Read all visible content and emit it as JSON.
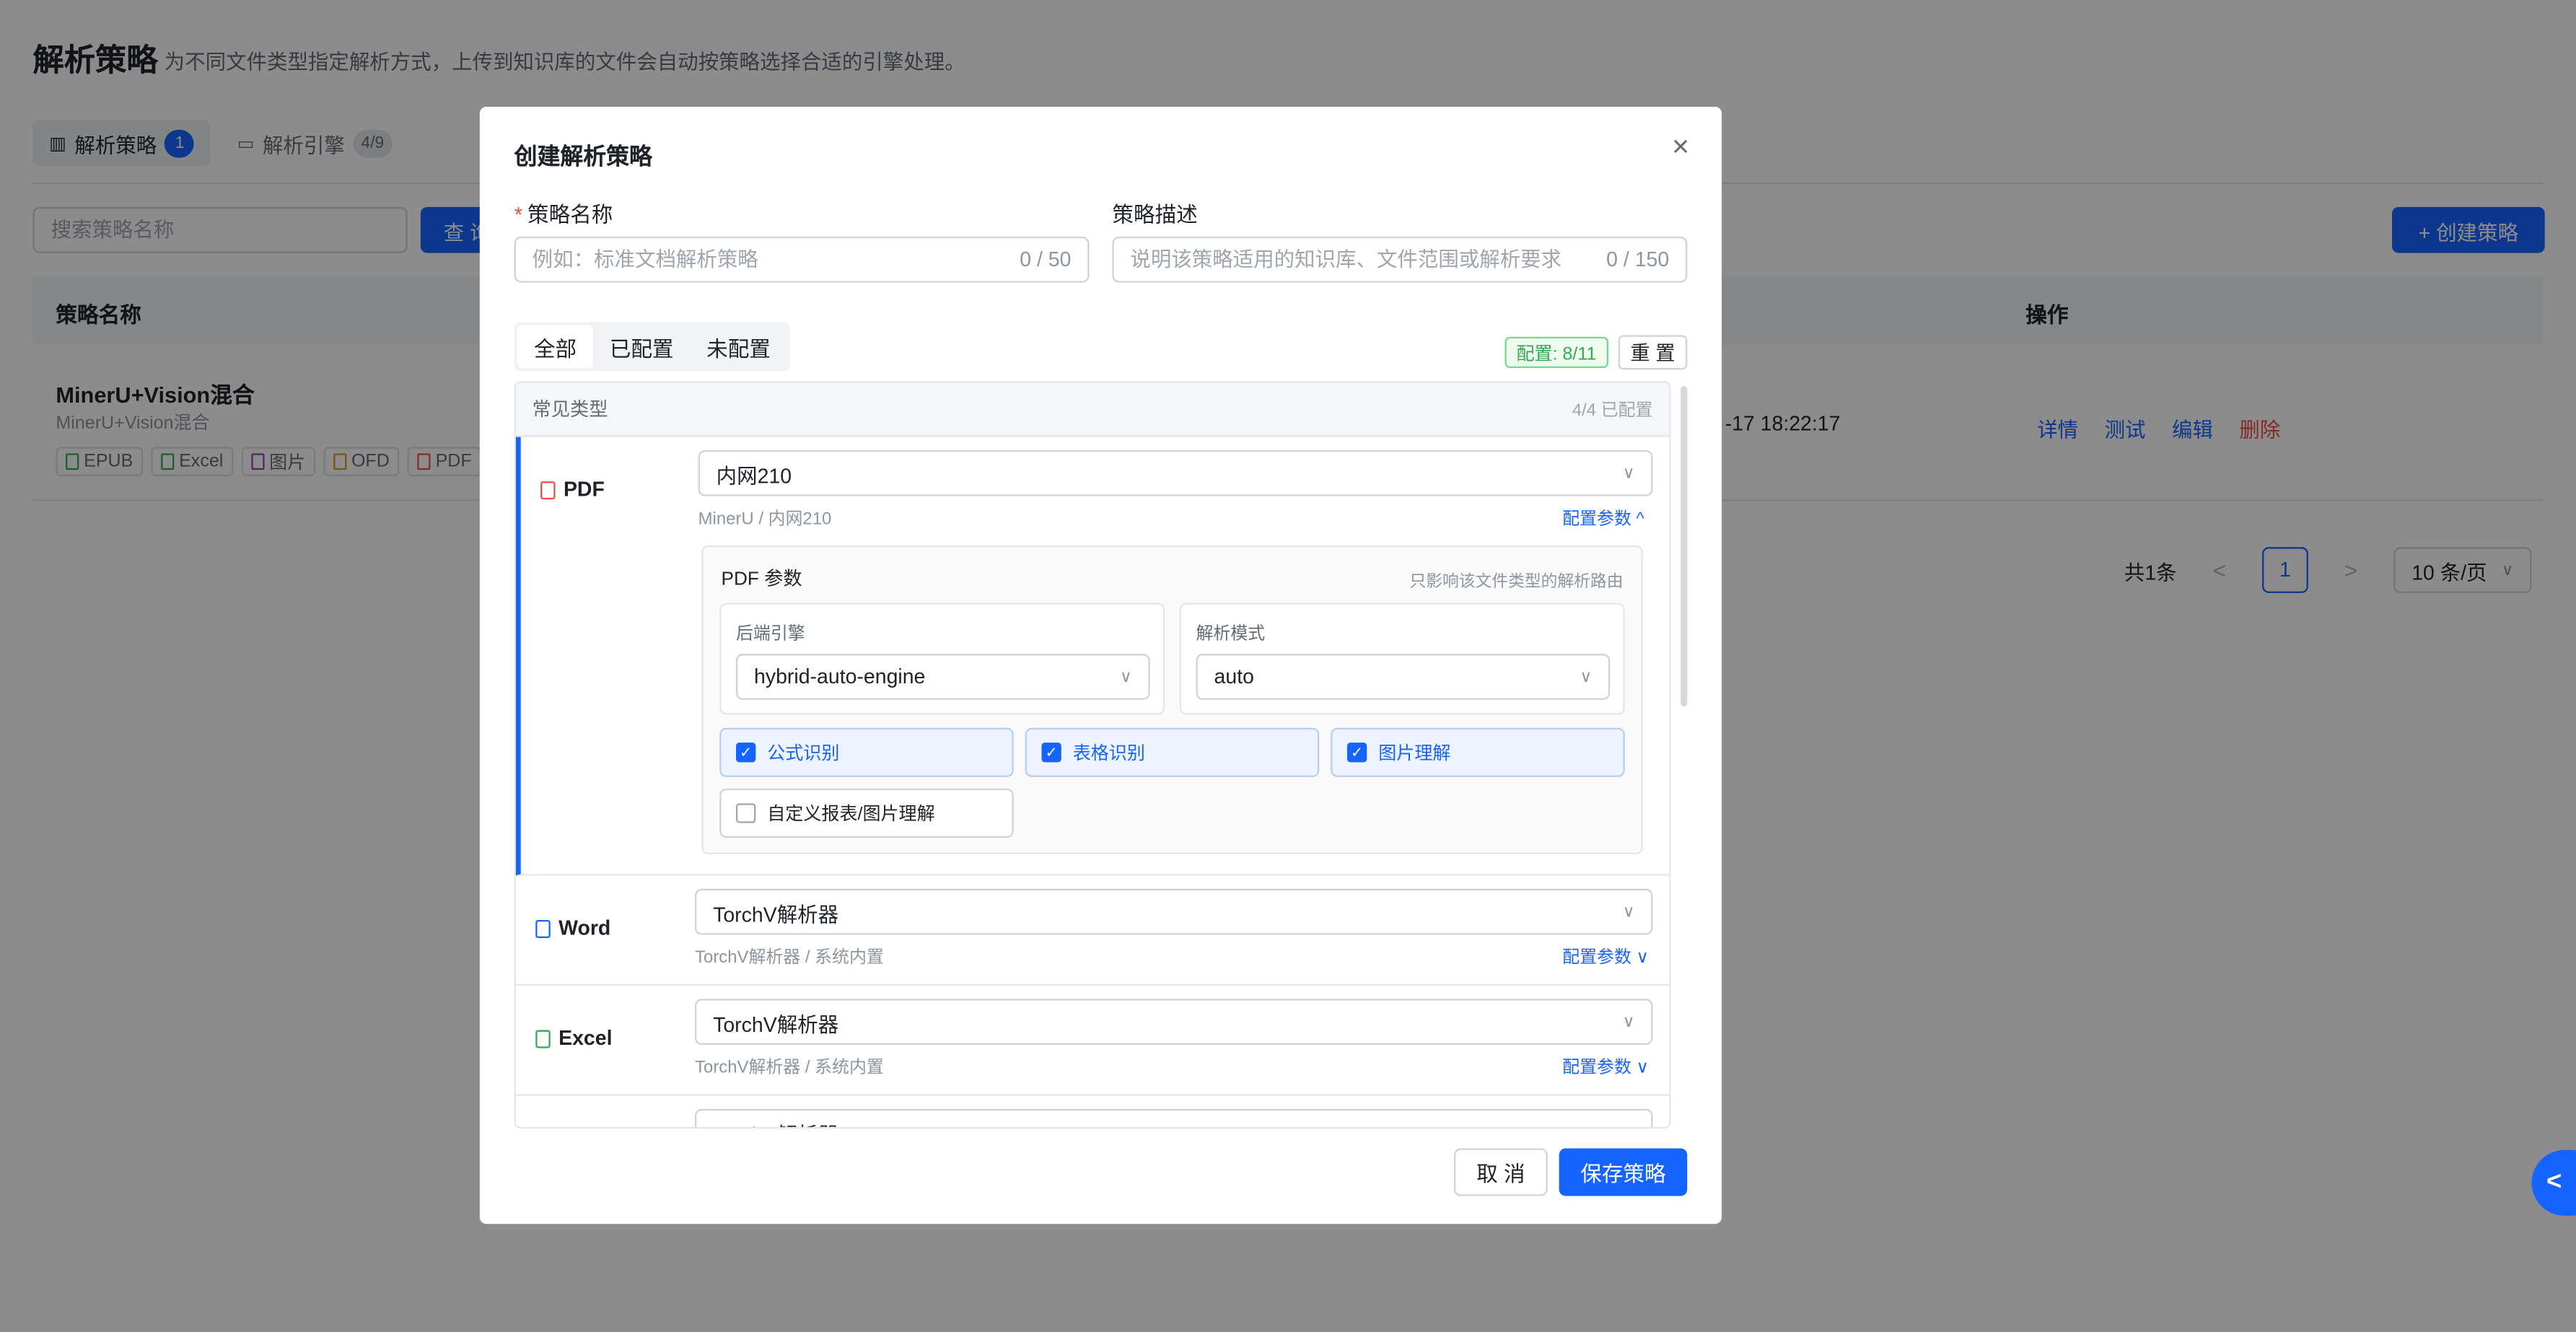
{
  "page": {
    "title": "解析策略",
    "subtitle": "为不同文件类型指定解析方式，上传到知识库的文件会自动按策略选择合适的引擎处理。",
    "tabs": [
      {
        "label": "解析策略",
        "badge": "1"
      },
      {
        "label": "解析引擎",
        "badge": "4/9"
      }
    ],
    "search_placeholder": "搜索策略名称",
    "query_button": "查 询",
    "create_button": "+ 创建策略",
    "table": {
      "col_name": "策略名称",
      "col_ops": "操作",
      "row": {
        "name": "MinerU+Vision混合",
        "sub": "MinerU+Vision混合",
        "tags": [
          "EPUB",
          "Excel",
          "图片",
          "OFD",
          "PDF"
        ],
        "time": "-17 18:22:17",
        "ops": [
          "详情",
          "测试",
          "编辑",
          "删除"
        ]
      }
    },
    "pager": {
      "total": "共1条",
      "prev": "<",
      "page": "1",
      "next": ">",
      "size": "10 条/页"
    },
    "side_fab": "<"
  },
  "modal": {
    "title": "创建解析策略",
    "close": "×",
    "name_label": "策略名称",
    "name_placeholder": "例如：标准文档解析策略",
    "name_count": "0 / 50",
    "desc_label": "策略描述",
    "desc_placeholder": "说明该策略适用的知识库、文件范围或解析要求",
    "desc_count": "0 / 150",
    "filters": [
      "全部",
      "已配置",
      "未配置"
    ],
    "config_badge": "配置: 8/11",
    "reset": "重 置",
    "section": {
      "title": "常见类型",
      "status": "4/4 已配置"
    },
    "pdf": {
      "name": "PDF",
      "engine": "内网210",
      "sub": "MinerU / 内网210",
      "cfg": "配置参数 ^",
      "params_title": "PDF 参数",
      "params_note": "只影响该文件类型的解析路由",
      "backend_label": "后端引擎",
      "backend_value": "hybrid-auto-engine",
      "mode_label": "解析模式",
      "mode_value": "auto",
      "checks": [
        {
          "label": "公式识别",
          "checked": true
        },
        {
          "label": "表格识别",
          "checked": true
        },
        {
          "label": "图片理解",
          "checked": true
        },
        {
          "label": "自定义报表/图片理解",
          "checked": false
        }
      ]
    },
    "word": {
      "name": "Word",
      "engine": "TorchV解析器",
      "sub": "TorchV解析器 / 系统内置",
      "cfg": "配置参数 ∨"
    },
    "excel": {
      "name": "Excel",
      "engine": "TorchV解析器",
      "sub": "TorchV解析器 / 系统内置",
      "cfg": "配置参数 ∨"
    },
    "next_engine": "TorchV解析器",
    "cancel": "取 消",
    "save": "保存策略"
  },
  "colors": {
    "primary": "#1664ff",
    "danger": "#f54a45",
    "success": "#34a853"
  }
}
